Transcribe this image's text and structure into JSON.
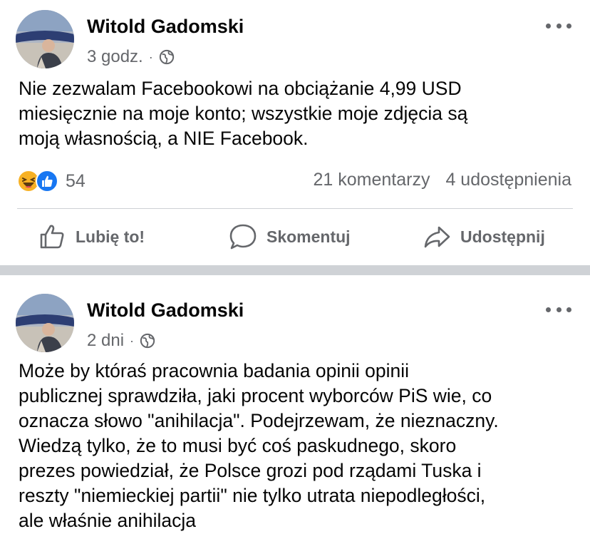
{
  "posts": [
    {
      "author": "Witold Gadomski",
      "time": "3 godz.",
      "separator": "·",
      "text_lines": [
        "Nie zezwalam Facebookowi na obciążanie 4,99 USD",
        "miesięcznie na moje konto; wszystkie moje zdjęcia są",
        "moją własnością, a NIE Facebook."
      ],
      "reactions_count": "54",
      "comments": "21 komentarzy",
      "shares": "4 udostępnienia",
      "actions": {
        "like": "Lubię to!",
        "comment": "Skomentuj",
        "share": "Udostępnij"
      }
    },
    {
      "author": "Witold Gadomski",
      "time": "2 dni",
      "separator": "·",
      "text_lines": [
        "Może by któraś pracownia badania opinii opinii",
        "publicznej sprawdziła, jaki procent wyborców PiS wie, co",
        "oznacza słowo \"anihilacja\". Podejrzewam, że nieznaczny.",
        "Wiedzą tylko, że to musi być coś paskudnego, skoro",
        "prezes powiedział, że Polsce grozi pod rządami Tuska i",
        "reszty \"niemieckiej partii\" nie tylko utrata niepodległości,",
        "ale właśnie anihilacja"
      ]
    }
  ],
  "icons": {
    "audience": "globe-icon",
    "more": "more-options-icon",
    "reactions": [
      "haha-reaction-icon",
      "like-reaction-icon"
    ],
    "like": "thumbs-up-icon",
    "comment": "comment-bubble-icon",
    "share": "share-arrow-icon"
  },
  "colors": {
    "text": "#050505",
    "secondary": "#65676b",
    "like_blue": "#1877f2",
    "haha_yellow": "#f7b125",
    "separator": "#cfd2d6"
  }
}
